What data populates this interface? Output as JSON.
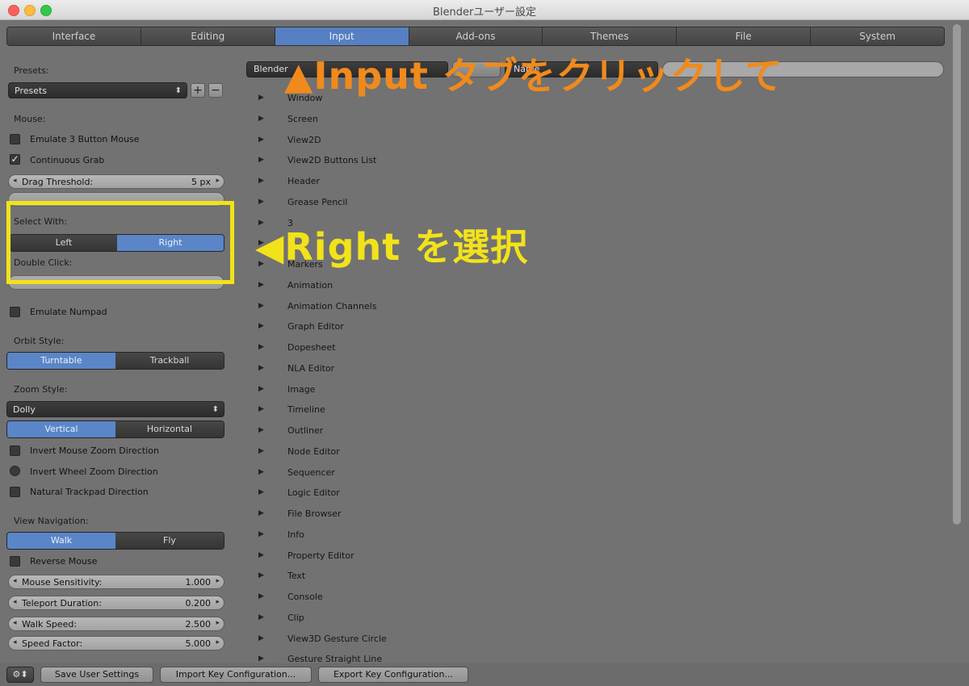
{
  "window": {
    "title": "Blenderユーザー設定"
  },
  "tabs": [
    "Interface",
    "Editing",
    "Input",
    "Add-ons",
    "Themes",
    "File",
    "System"
  ],
  "active_tab": "Input",
  "left": {
    "presets_label": "Presets:",
    "presets_value": "Presets",
    "mouse_label": "Mouse:",
    "emulate3": "Emulate 3 Button Mouse",
    "continuous_grab": "Continuous Grab",
    "drag_threshold_label": "Drag Threshold:",
    "drag_threshold_value": "5 px",
    "select_with_label": "Select With:",
    "select_left": "Left",
    "select_right": "Right",
    "double_click_label": "Double Click:",
    "emulate_numpad": "Emulate Numpad",
    "orbit_style_label": "Orbit Style:",
    "orbit_turntable": "Turntable",
    "orbit_trackball": "Trackball",
    "zoom_style_label": "Zoom Style:",
    "zoom_style_value": "Dolly",
    "zoom_vertical": "Vertical",
    "zoom_horizontal": "Horizontal",
    "invert_mouse_zoom": "Invert Mouse Zoom Direction",
    "invert_wheel_zoom": "Invert Wheel Zoom Direction",
    "natural_trackpad": "Natural Trackpad Direction",
    "view_nav_label": "View Navigation:",
    "nav_walk": "Walk",
    "nav_fly": "Fly",
    "reverse_mouse": "Reverse Mouse",
    "mouse_sens_label": "Mouse Sensitivity:",
    "mouse_sens_value": "1.000",
    "teleport_label": "Teleport Duration:",
    "teleport_value": "0.200",
    "walk_speed_label": "Walk Speed:",
    "walk_speed_value": "2.500",
    "speed_factor_label": "Speed Factor:",
    "speed_factor_value": "5.000"
  },
  "right": {
    "keyconfig_value": "Blender",
    "name_value": "Name",
    "items": [
      "Window",
      "Screen",
      "View2D",
      "View2D Buttons List",
      "Header",
      "Grease Pencil",
      "3",
      "Fr",
      "Markers",
      "Animation",
      "Animation Channels",
      "Graph Editor",
      "Dopesheet",
      "NLA Editor",
      "Image",
      "Timeline",
      "Outliner",
      "Node Editor",
      "Sequencer",
      "Logic Editor",
      "File Browser",
      "Info",
      "Property Editor",
      "Text",
      "Console",
      "Clip",
      "View3D Gesture Circle",
      "Gesture Straight Line"
    ]
  },
  "bottom": {
    "save": "Save User Settings",
    "import": "Import Key Configuration...",
    "export": "Export Key Configuration..."
  },
  "annotations": {
    "input_tab_note": "▲Input タブをクリックして",
    "right_note": "◀Right を選択"
  },
  "colors": {
    "accent_blue": "#5680c2",
    "highlight_yellow": "#f2e21a",
    "note_orange": "#f08a1c"
  }
}
